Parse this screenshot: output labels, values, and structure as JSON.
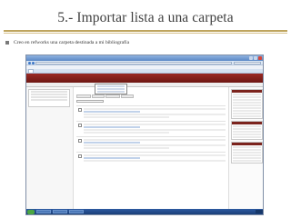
{
  "slide": {
    "title": "5.- Importar lista a una carpeta",
    "bullet": "Creo en refworks una carpeta destinada a mi bibliografía"
  },
  "colors": {
    "accent_rule": "#bfa55e",
    "refworks_red": "#7b231d",
    "window_blue": "#5a87c6"
  },
  "icons": [
    "bullet-square-icon",
    "close-icon",
    "back-arrow-icon",
    "start-button-icon"
  ]
}
